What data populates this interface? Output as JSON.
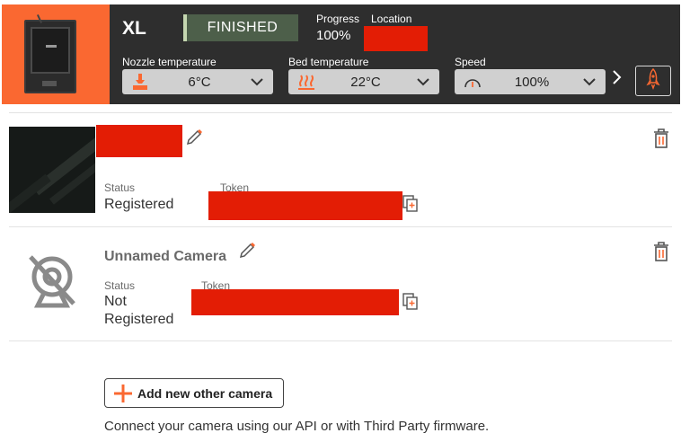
{
  "printer": {
    "name": "XL",
    "state": "FINISHED",
    "progress_label": "Progress",
    "progress_value": "100%",
    "location_label": "Location",
    "location_value": "",
    "nozzle": {
      "label": "Nozzle temperature",
      "value": "6°C",
      "icon": "nozzle-heat-icon"
    },
    "bed": {
      "label": "Bed temperature",
      "value": "22°C",
      "icon": "bed-heat-icon"
    },
    "speed": {
      "label": "Speed",
      "value": "100%",
      "icon": "speedometer-icon"
    },
    "accent_color": "#fa6831"
  },
  "cameras": [
    {
      "name": "",
      "status_label": "Status",
      "status_value": "Registered",
      "token_label": "Token",
      "token_value": ""
    },
    {
      "name": "Unnamed Camera",
      "status_label": "Status",
      "status_value_line1": "Not",
      "status_value_line2": "Registered",
      "token_label": "Token",
      "token_value": ""
    }
  ],
  "add_button": {
    "label": "Add new other camera",
    "icon": "plus-icon"
  },
  "footnote": "Connect your camera using our API or with Third Party firmware.",
  "colors": {
    "redaction": "#e31d05",
    "header_bg": "#2e2e2e",
    "badge_bg": "#4d5f4a",
    "accent": "#fa6831"
  }
}
